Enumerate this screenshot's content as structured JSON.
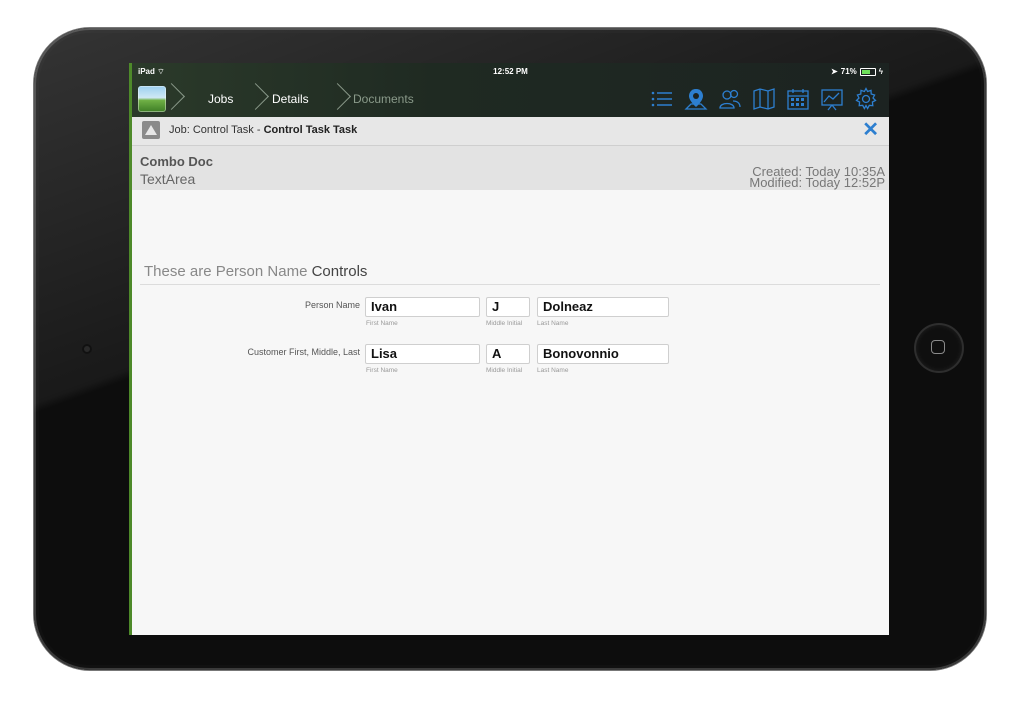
{
  "status": {
    "carrier": "iPad",
    "time": "12:52 PM",
    "battery": "71%",
    "battery_level": 0.71
  },
  "nav": {
    "crumbs": [
      {
        "label": "Jobs",
        "active": true
      },
      {
        "label": "Details",
        "active": true
      },
      {
        "label": "Documents",
        "active": false
      }
    ],
    "tools": [
      "list-icon",
      "map-pin-icon",
      "people-icon",
      "map-icon",
      "calendar-icon",
      "chart-icon",
      "gear-icon"
    ],
    "accent": "#2d7fd0"
  },
  "job": {
    "prefix": "Job: Control Task - ",
    "name": "Control Task Task",
    "close": "✕"
  },
  "doc": {
    "name": "Combo Doc",
    "type": "TextArea",
    "created": "Created: Today 10:35A",
    "modified": "Modified: Today 12:52P"
  },
  "section": {
    "title_plain": "These are Person Name ",
    "title_emph": "Controls"
  },
  "rows": [
    {
      "label": "Person Name",
      "first": "Ivan",
      "middle": "J",
      "last": "Dolneaz",
      "first_caption": "First Name",
      "middle_caption": "Middle Initial",
      "last_caption": "Last Name"
    },
    {
      "label": "Customer First, Middle, Last",
      "first": "Lisa",
      "middle": "A",
      "last": "Bonovonnio",
      "first_caption": "First Name",
      "middle_caption": "Middle Initial",
      "last_caption": "Last Name"
    }
  ]
}
